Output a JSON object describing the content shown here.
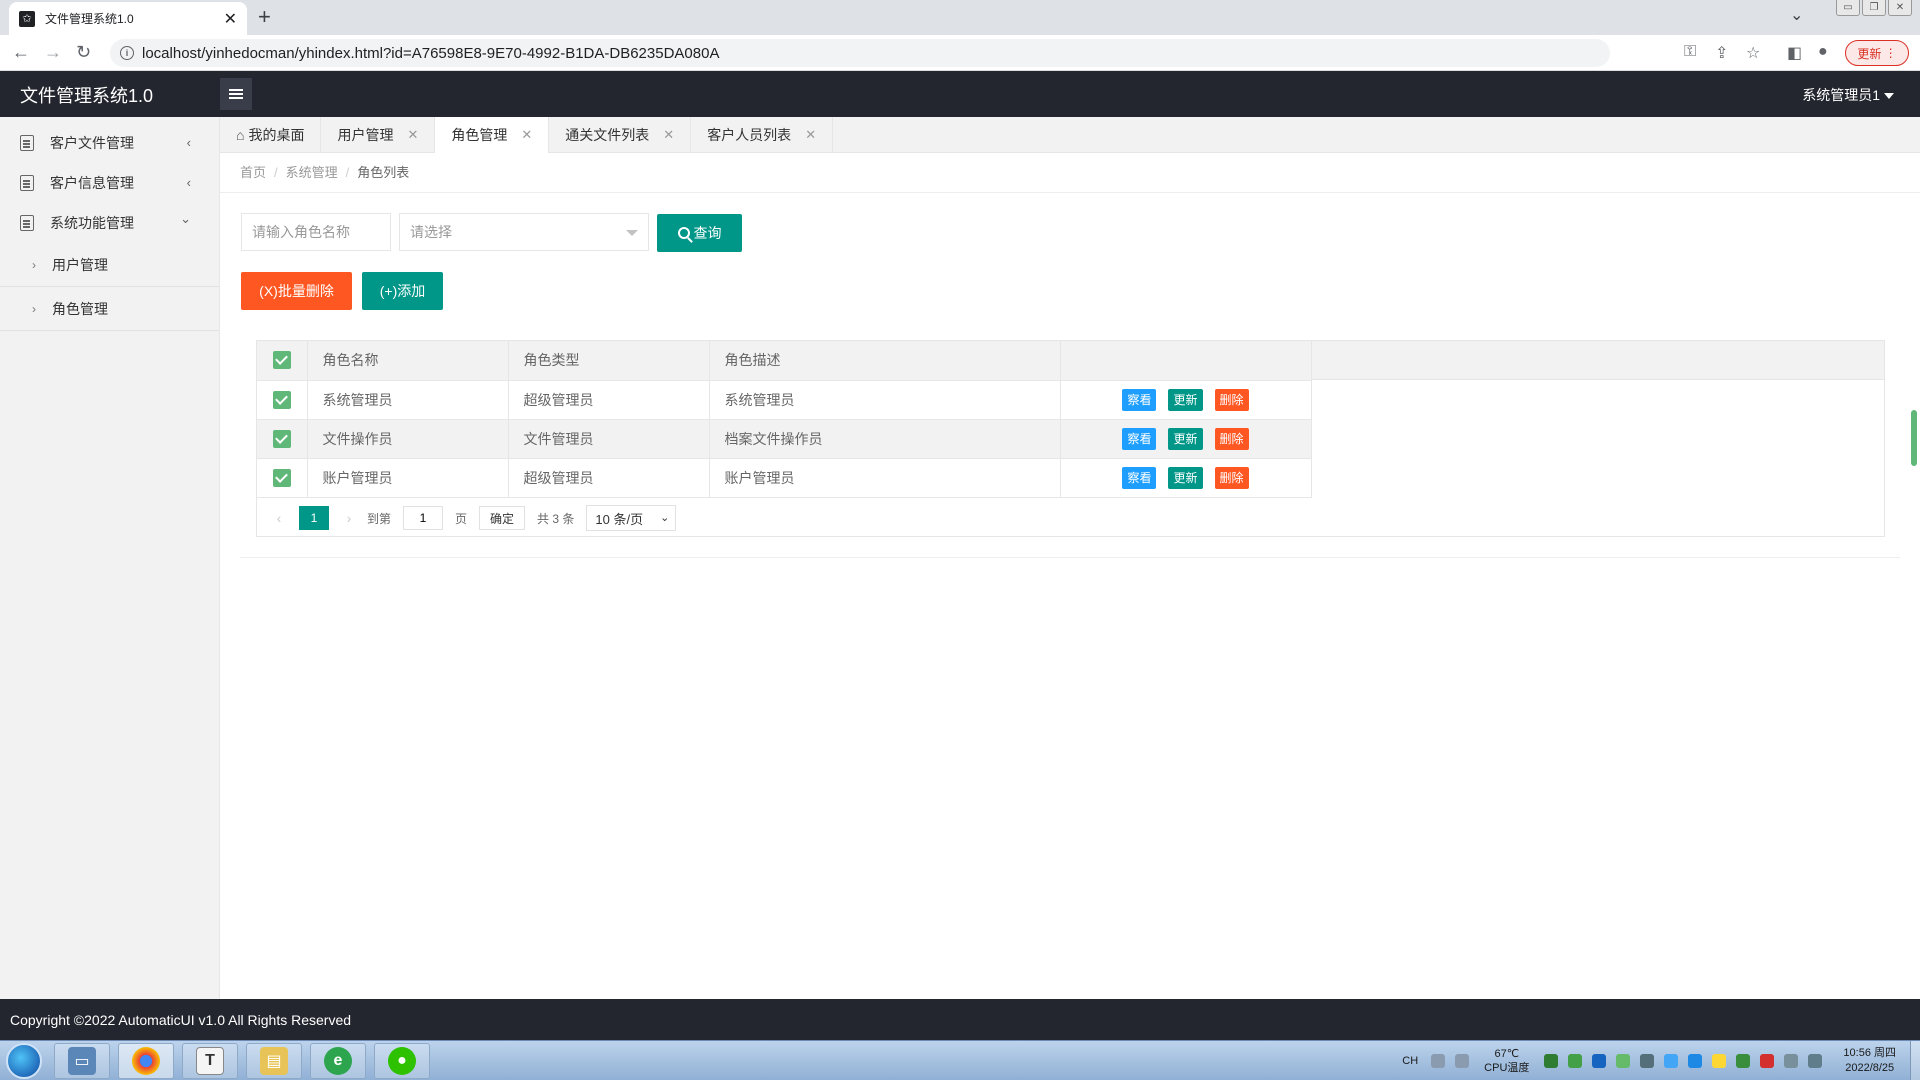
{
  "browser": {
    "tab_title": "文件管理系统1.0",
    "new_tab": "+",
    "close": "✕",
    "url": "localhost/yinhedocman/yhindex.html?id=A76598E8-9E70-4992-B1DA-DB6235DA080A",
    "update_label": "更新"
  },
  "header": {
    "app_title": "文件管理系统1.0",
    "user": "系统管理员1"
  },
  "sidebar": {
    "items": [
      {
        "label": "客户文件管理",
        "arrow": "‹"
      },
      {
        "label": "客户信息管理",
        "arrow": "‹"
      },
      {
        "label": "系统功能管理",
        "arrow": "⌄"
      }
    ],
    "subitems": [
      {
        "label": "用户管理"
      },
      {
        "label": "角色管理"
      }
    ]
  },
  "page_tabs": [
    {
      "label": "我的桌面",
      "closable": false
    },
    {
      "label": "用户管理",
      "closable": true
    },
    {
      "label": "角色管理",
      "closable": true,
      "active": true
    },
    {
      "label": "通关文件列表",
      "closable": true
    },
    {
      "label": "客户人员列表",
      "closable": true
    }
  ],
  "breadcrumb": {
    "items": [
      "首页",
      "系统管理",
      "角色列表"
    ],
    "separator": "/"
  },
  "search": {
    "name_placeholder": "请输入角色名称",
    "select_placeholder": "请选择",
    "query_label": "查询"
  },
  "actions": {
    "batch_delete_label": "(X)批量删除",
    "add_label": "(+)添加"
  },
  "table": {
    "columns": [
      "角色名称",
      "角色类型",
      "角色描述",
      ""
    ],
    "rows": [
      {
        "name": "系统管理员",
        "type": "超级管理员",
        "desc": "系统管理员",
        "checked": true
      },
      {
        "name": "文件操作员",
        "type": "文件管理员",
        "desc": "档案文件操作员",
        "checked": true
      },
      {
        "name": "账户管理员",
        "type": "超级管理员",
        "desc": "账户管理员",
        "checked": true
      }
    ],
    "row_actions": {
      "view": "察看",
      "update": "更新",
      "delete": "删除"
    },
    "header_checked": true
  },
  "pager": {
    "prev": "‹",
    "next": "›",
    "current_page": "1",
    "goto_label": "到第",
    "goto_value": "1",
    "page_unit": "页",
    "confirm_label": "确定",
    "total_label": "共 3 条",
    "page_size": "10 条/页"
  },
  "footer": {
    "text": "Copyright ©2022 AutomaticUI v1.0 All Rights Reserved"
  },
  "taskbar": {
    "lang": "CH",
    "temp": "67℃",
    "temp_label": "CPU温度",
    "time": "10:56 周四",
    "date": "2022/8/25"
  },
  "colors": {
    "primary": "#009688",
    "danger": "#ff5722",
    "info": "#1e9fff",
    "header_bg": "#23262e",
    "checkbox": "#5fb878"
  }
}
